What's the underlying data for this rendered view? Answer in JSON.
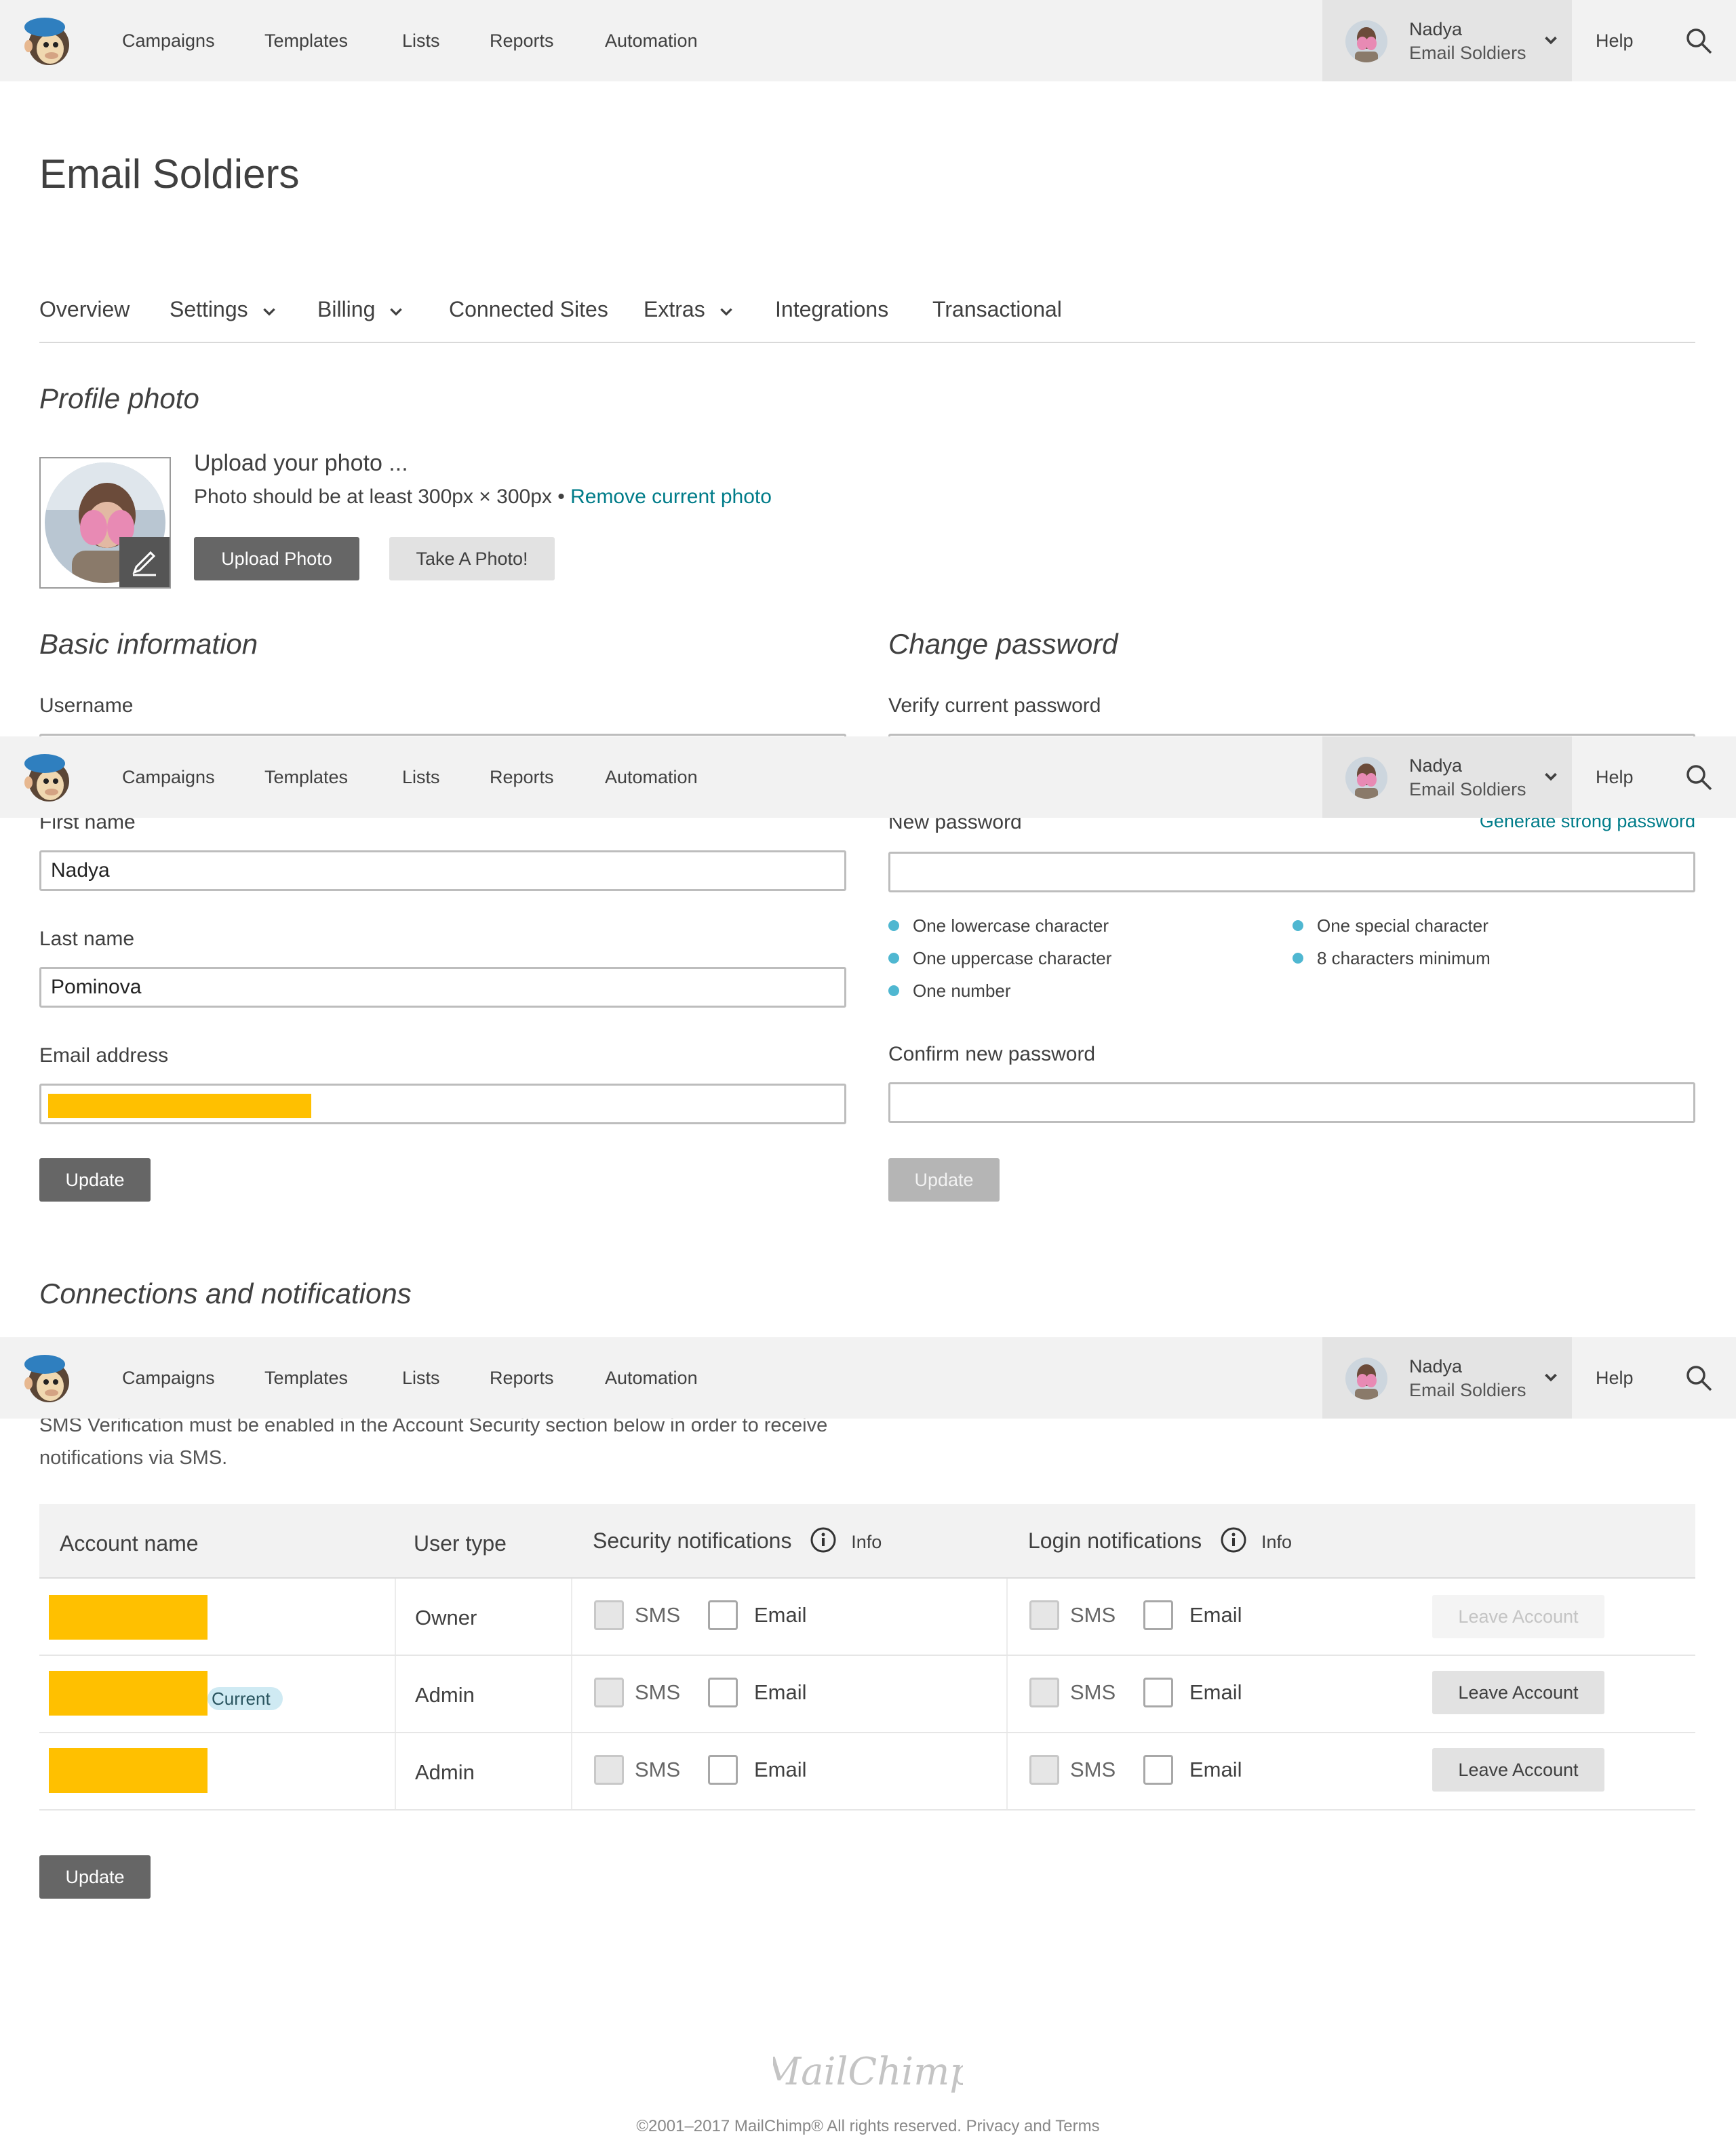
{
  "nav": {
    "links": [
      "Campaigns",
      "Templates",
      "Lists",
      "Reports",
      "Automation"
    ],
    "user_name": "Nadya",
    "user_account": "Email Soldiers",
    "help": "Help"
  },
  "page_title": "Email Soldiers",
  "tabs": [
    "Overview",
    "Settings",
    "Billing",
    "Connected Sites",
    "Extras",
    "Integrations",
    "Transactional"
  ],
  "profile": {
    "title": "Profile photo",
    "upload_heading": "Upload your photo ...",
    "hint": "Photo should be at least 300px × 300px •",
    "remove_link": "Remove current photo",
    "upload_button": "Upload Photo",
    "take_photo_button": "Take A Photo!"
  },
  "basic": {
    "title": "Basic information",
    "username_label": "Username",
    "first_name_label": "First name",
    "first_name_value": "Nadya",
    "last_name_label": "Last name",
    "last_name_value": "Pominova",
    "email_label": "Email address",
    "update_button": "Update"
  },
  "password": {
    "title": "Change password",
    "verify_label": "Verify current password",
    "new_label": "New password",
    "generate_link": "Generate strong password",
    "requirements": [
      "One lowercase character",
      "One uppercase character",
      "One number",
      "One special character",
      "8 characters minimum"
    ],
    "confirm_label": "Confirm new password",
    "update_button": "Update"
  },
  "connections": {
    "title": "Connections and notifications",
    "sms_note_line1": "SMS Verification must be enabled in the Account Security section below in order to receive",
    "sms_note_line2": "notifications via SMS.",
    "headers": {
      "account_name": "Account name",
      "user_type": "User type",
      "security": "Security notifications",
      "login": "Login notifications",
      "info": "Info"
    },
    "sms_label": "SMS",
    "email_label": "Email",
    "current_badge": "Current",
    "rows": [
      {
        "user_type": "Owner",
        "leave": "Leave Account",
        "leave_enabled": false,
        "current": false
      },
      {
        "user_type": "Admin",
        "leave": "Leave Account",
        "leave_enabled": true,
        "current": true
      },
      {
        "user_type": "Admin",
        "leave": "Leave Account",
        "leave_enabled": true,
        "current": false
      }
    ],
    "update_button": "Update"
  },
  "footer": {
    "logo_text": "MailChimp",
    "copyright": "©2001–2017 MailChimp® All rights reserved. Privacy and Terms"
  },
  "colors": {
    "nav_bg": "#f2f2f2",
    "link": "#007c89",
    "redaction": "#ffc000",
    "requirement_dot": "#4fb7d1",
    "dark_button": "#666666"
  }
}
